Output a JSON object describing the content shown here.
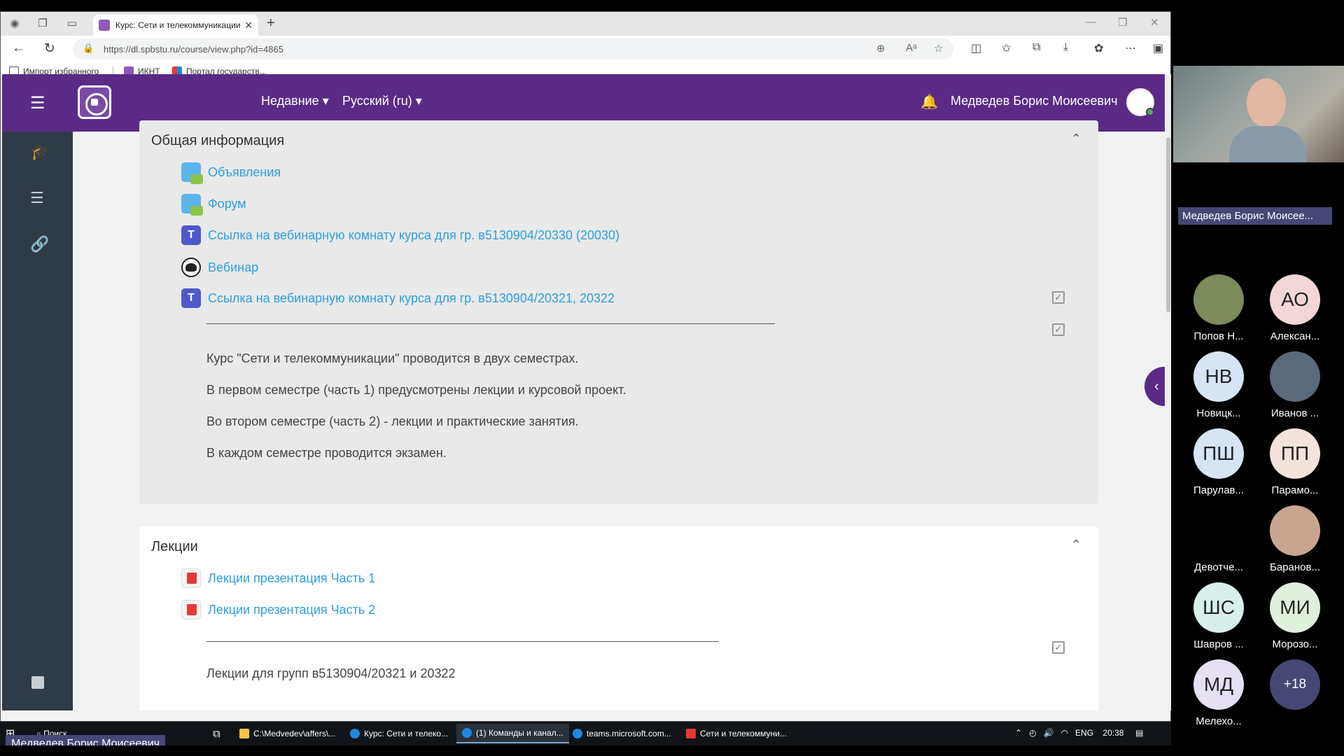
{
  "browser": {
    "tab_title": "Курс: Сети и телекоммуникации",
    "url_host": "https://dl.spbstu.ru",
    "url_path": "/course/view.php?id=4865",
    "bookmarks": [
      {
        "label": "Импорт избранного"
      },
      {
        "label": "ИКНТ"
      },
      {
        "label": "Портал государств..."
      }
    ]
  },
  "navbar": {
    "recent_label": "Недавние",
    "language_label": "Русский (ru)",
    "user_name": "Медведев Борис Моисеевич"
  },
  "sections": {
    "general": {
      "title": "Общая информация",
      "activities": [
        {
          "label": "Объявления",
          "icon": "forum-icon"
        },
        {
          "label": "Форум",
          "icon": "forum-icon"
        },
        {
          "label": "Ссылка на вебинарную комнату курса для гр. в5130904/20330 (20030)",
          "icon": "teams-icon"
        },
        {
          "label": "Вебинар",
          "icon": "webinar-icon"
        },
        {
          "label": "Ссылка на вебинарную комнату курса для гр. в5130904/20321, 20322",
          "icon": "teams-icon"
        }
      ],
      "paragraphs": [
        "Курс \"Сети и телекоммуникации\" проводится в двух семестрах.",
        "В первом семестре (часть 1) предусмотрены лекции и курсовой проект.",
        "Во втором семестре (часть 2) - лекции и практические занятия.",
        "В каждом семестре проводится экзамен."
      ]
    },
    "lectures": {
      "title": "Лекции",
      "activities": [
        {
          "label": "Лекции презентация Часть 1",
          "icon": "pdf-icon"
        },
        {
          "label": "Лекции презентация Часть 2",
          "icon": "pdf-icon"
        }
      ],
      "paragraphs": [
        "Лекции для групп в5130904/20321 и 20322"
      ]
    }
  },
  "teams": {
    "speaker_label": "Медведев Борис Моисее...",
    "participants": [
      {
        "initials": "",
        "name": "Попов Н...",
        "color": "#7d8a5a"
      },
      {
        "initials": "АО",
        "name": "Алексан...",
        "color": "#f3d6d8"
      },
      {
        "initials": "НВ",
        "name": "Новицк...",
        "color": "#d6e4f3"
      },
      {
        "initials": "",
        "name": "Иванов ...",
        "color": "#5a6a7a"
      },
      {
        "initials": "ПШ",
        "name": "Парулав...",
        "color": "#d6e4f3"
      },
      {
        "initials": "ПП",
        "name": "Парамо...",
        "color": "#f3e3dd"
      },
      {
        "initials": "",
        "name": "Девотче...",
        "color": "#000000"
      },
      {
        "initials": "",
        "name": "Баранов...",
        "color": "#c9a58f"
      },
      {
        "initials": "ШС",
        "name": "Шавров ...",
        "color": "#d8f0ec"
      },
      {
        "initials": "МИ",
        "name": "Морозо...",
        "color": "#dff0dc"
      },
      {
        "initials": "МД",
        "name": "Мелехо...",
        "color": "#e6e0f3"
      },
      {
        "initials": "+18",
        "name": "",
        "color": "#464775"
      }
    ]
  },
  "taskbar": {
    "search_label": "Поиск",
    "items": [
      {
        "label": "C:\\Medvedev\\affers\\..."
      },
      {
        "label": "Курс: Сети и телеко..."
      },
      {
        "label": "(1) Команды и канал..."
      },
      {
        "label": "teams.microsoft.com..."
      },
      {
        "label": "Сети и телекоммуни..."
      }
    ],
    "lang": "ENG",
    "time": "20:38"
  },
  "presenter_label": "Медведев Борис Моисеевич"
}
